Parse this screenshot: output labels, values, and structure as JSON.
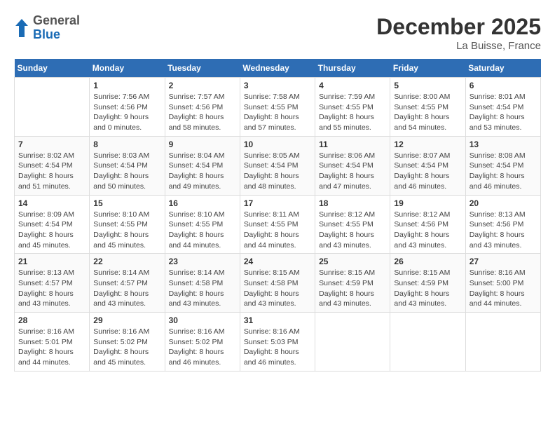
{
  "header": {
    "logo": {
      "general": "General",
      "blue": "Blue"
    },
    "title": "December 2025",
    "location": "La Buisse, France"
  },
  "days_of_week": [
    "Sunday",
    "Monday",
    "Tuesday",
    "Wednesday",
    "Thursday",
    "Friday",
    "Saturday"
  ],
  "weeks": [
    [
      {
        "day": "",
        "info": ""
      },
      {
        "day": "1",
        "info": "Sunrise: 7:56 AM\nSunset: 4:56 PM\nDaylight: 9 hours\nand 0 minutes."
      },
      {
        "day": "2",
        "info": "Sunrise: 7:57 AM\nSunset: 4:56 PM\nDaylight: 8 hours\nand 58 minutes."
      },
      {
        "day": "3",
        "info": "Sunrise: 7:58 AM\nSunset: 4:55 PM\nDaylight: 8 hours\nand 57 minutes."
      },
      {
        "day": "4",
        "info": "Sunrise: 7:59 AM\nSunset: 4:55 PM\nDaylight: 8 hours\nand 55 minutes."
      },
      {
        "day": "5",
        "info": "Sunrise: 8:00 AM\nSunset: 4:55 PM\nDaylight: 8 hours\nand 54 minutes."
      },
      {
        "day": "6",
        "info": "Sunrise: 8:01 AM\nSunset: 4:54 PM\nDaylight: 8 hours\nand 53 minutes."
      }
    ],
    [
      {
        "day": "7",
        "info": "Sunrise: 8:02 AM\nSunset: 4:54 PM\nDaylight: 8 hours\nand 51 minutes."
      },
      {
        "day": "8",
        "info": "Sunrise: 8:03 AM\nSunset: 4:54 PM\nDaylight: 8 hours\nand 50 minutes."
      },
      {
        "day": "9",
        "info": "Sunrise: 8:04 AM\nSunset: 4:54 PM\nDaylight: 8 hours\nand 49 minutes."
      },
      {
        "day": "10",
        "info": "Sunrise: 8:05 AM\nSunset: 4:54 PM\nDaylight: 8 hours\nand 48 minutes."
      },
      {
        "day": "11",
        "info": "Sunrise: 8:06 AM\nSunset: 4:54 PM\nDaylight: 8 hours\nand 47 minutes."
      },
      {
        "day": "12",
        "info": "Sunrise: 8:07 AM\nSunset: 4:54 PM\nDaylight: 8 hours\nand 46 minutes."
      },
      {
        "day": "13",
        "info": "Sunrise: 8:08 AM\nSunset: 4:54 PM\nDaylight: 8 hours\nand 46 minutes."
      }
    ],
    [
      {
        "day": "14",
        "info": "Sunrise: 8:09 AM\nSunset: 4:54 PM\nDaylight: 8 hours\nand 45 minutes."
      },
      {
        "day": "15",
        "info": "Sunrise: 8:10 AM\nSunset: 4:55 PM\nDaylight: 8 hours\nand 45 minutes."
      },
      {
        "day": "16",
        "info": "Sunrise: 8:10 AM\nSunset: 4:55 PM\nDaylight: 8 hours\nand 44 minutes."
      },
      {
        "day": "17",
        "info": "Sunrise: 8:11 AM\nSunset: 4:55 PM\nDaylight: 8 hours\nand 44 minutes."
      },
      {
        "day": "18",
        "info": "Sunrise: 8:12 AM\nSunset: 4:55 PM\nDaylight: 8 hours\nand 43 minutes."
      },
      {
        "day": "19",
        "info": "Sunrise: 8:12 AM\nSunset: 4:56 PM\nDaylight: 8 hours\nand 43 minutes."
      },
      {
        "day": "20",
        "info": "Sunrise: 8:13 AM\nSunset: 4:56 PM\nDaylight: 8 hours\nand 43 minutes."
      }
    ],
    [
      {
        "day": "21",
        "info": "Sunrise: 8:13 AM\nSunset: 4:57 PM\nDaylight: 8 hours\nand 43 minutes."
      },
      {
        "day": "22",
        "info": "Sunrise: 8:14 AM\nSunset: 4:57 PM\nDaylight: 8 hours\nand 43 minutes."
      },
      {
        "day": "23",
        "info": "Sunrise: 8:14 AM\nSunset: 4:58 PM\nDaylight: 8 hours\nand 43 minutes."
      },
      {
        "day": "24",
        "info": "Sunrise: 8:15 AM\nSunset: 4:58 PM\nDaylight: 8 hours\nand 43 minutes."
      },
      {
        "day": "25",
        "info": "Sunrise: 8:15 AM\nSunset: 4:59 PM\nDaylight: 8 hours\nand 43 minutes."
      },
      {
        "day": "26",
        "info": "Sunrise: 8:15 AM\nSunset: 4:59 PM\nDaylight: 8 hours\nand 43 minutes."
      },
      {
        "day": "27",
        "info": "Sunrise: 8:16 AM\nSunset: 5:00 PM\nDaylight: 8 hours\nand 44 minutes."
      }
    ],
    [
      {
        "day": "28",
        "info": "Sunrise: 8:16 AM\nSunset: 5:01 PM\nDaylight: 8 hours\nand 44 minutes."
      },
      {
        "day": "29",
        "info": "Sunrise: 8:16 AM\nSunset: 5:02 PM\nDaylight: 8 hours\nand 45 minutes."
      },
      {
        "day": "30",
        "info": "Sunrise: 8:16 AM\nSunset: 5:02 PM\nDaylight: 8 hours\nand 46 minutes."
      },
      {
        "day": "31",
        "info": "Sunrise: 8:16 AM\nSunset: 5:03 PM\nDaylight: 8 hours\nand 46 minutes."
      },
      {
        "day": "",
        "info": ""
      },
      {
        "day": "",
        "info": ""
      },
      {
        "day": "",
        "info": ""
      }
    ]
  ]
}
